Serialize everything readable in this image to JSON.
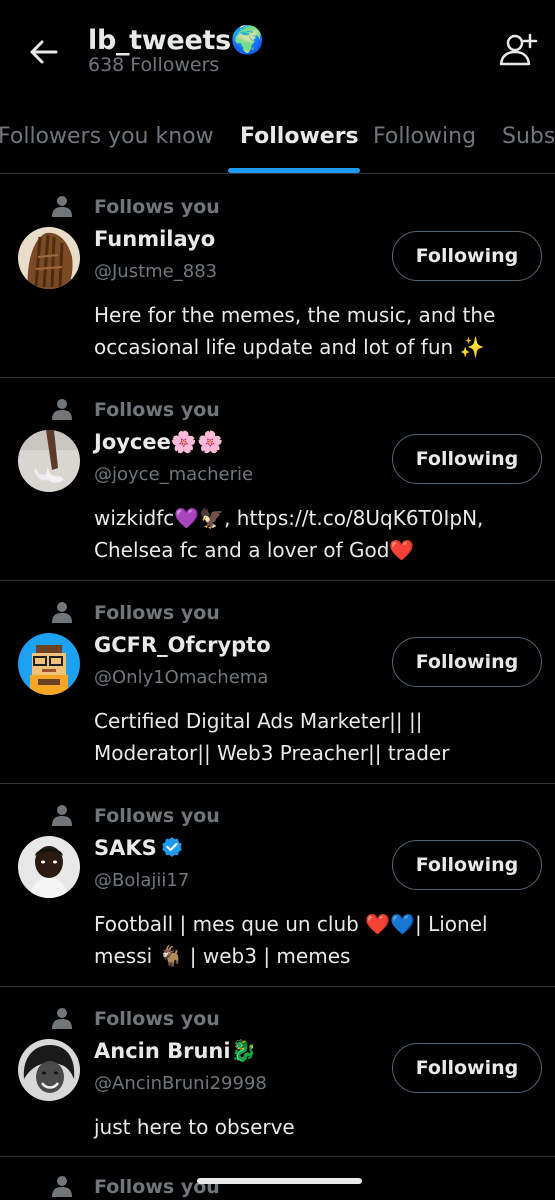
{
  "header": {
    "title": "lb_tweets🌍",
    "subtitle": "638 Followers",
    "back_icon": "arrow-left-icon",
    "add_icon": "person-add-icon"
  },
  "tabs": [
    {
      "label": "Followers you know",
      "active": false
    },
    {
      "label": "Followers",
      "active": true
    },
    {
      "label": "Following",
      "active": false
    },
    {
      "label": "Subs",
      "active": false
    }
  ],
  "colors": {
    "background": "#000000",
    "text": "#e7e9ea",
    "muted": "#71767b",
    "accent": "#1d9bf0",
    "border": "#2f3336"
  },
  "followers": [
    {
      "follows_you": "Follows you",
      "name": "Funmilayo",
      "handle": "@Justme_883",
      "button": "Following",
      "bio": "Here for the memes, the music, and the occasional life update and lot of fun  ✨",
      "verified": false
    },
    {
      "follows_you": "Follows you",
      "name": "Joycee🌸🌸",
      "handle": "@joyce_macherie",
      "button": "Following",
      "bio": "wizkidfc💜🦅, https://t.co/8UqK6T0IpN, Chelsea fc and a lover of God❤️",
      "verified": false
    },
    {
      "follows_you": "Follows you",
      "name": "GCFR_Ofcrypto",
      "handle": "@Only1Omachema",
      "button": "Following",
      "bio": "Certified Digital Ads Marketer|| || Moderator|| Web3 Preacher|| trader",
      "verified": false
    },
    {
      "follows_you": "Follows you",
      "name": "SAKS",
      "handle": "@Bolajii17",
      "button": "Following",
      "bio": "Football | mes que un club ❤️💙| Lionel messi  🐐 | web3 | memes",
      "verified": true
    },
    {
      "follows_you": "Follows you",
      "name": "Ancin Bruni🐉",
      "handle": "@AncinBruni29998",
      "button": "Following",
      "bio": "just here to observe",
      "verified": false
    }
  ],
  "partial_item": {
    "follows_you": "Follows you"
  }
}
